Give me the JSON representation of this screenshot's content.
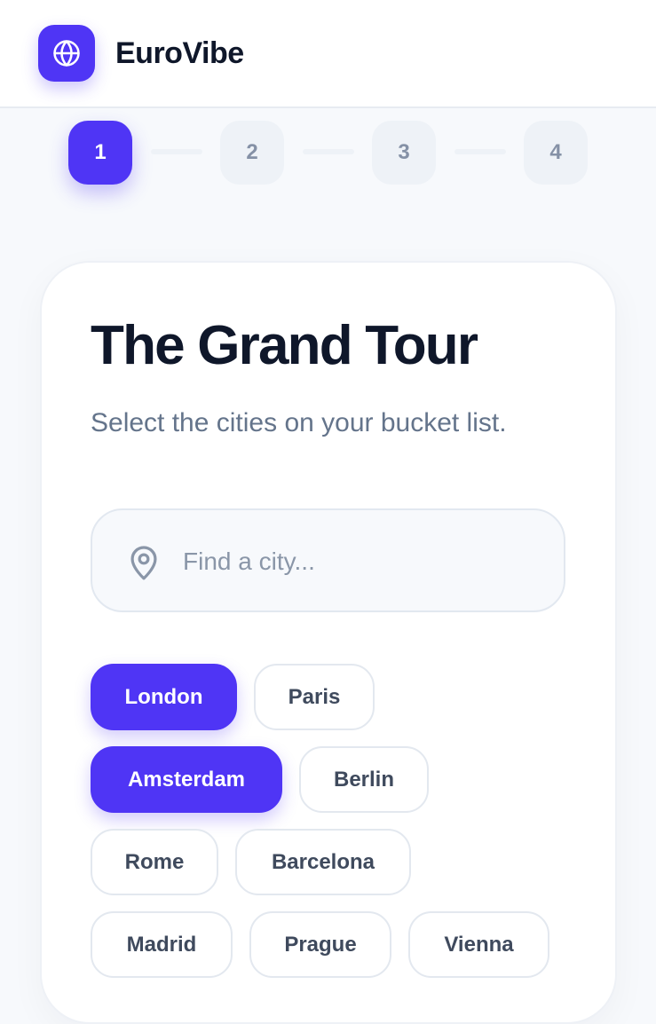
{
  "app": {
    "brand": "EuroVibe",
    "logo_icon": "globe-icon",
    "accent_color": "#4f35f5"
  },
  "stepper": {
    "steps": [
      {
        "label": "1",
        "active": true
      },
      {
        "label": "2",
        "active": false
      },
      {
        "label": "3",
        "active": false
      },
      {
        "label": "4",
        "active": false
      }
    ]
  },
  "main": {
    "title": "The Grand Tour",
    "subtitle": "Select the cities on your bucket list.",
    "search": {
      "placeholder": "Find a city...",
      "value": "",
      "icon": "map-pin-icon"
    },
    "cities": [
      {
        "label": "London",
        "selected": true
      },
      {
        "label": "Paris",
        "selected": false
      },
      {
        "label": "Amsterdam",
        "selected": true
      },
      {
        "label": "Berlin",
        "selected": false
      },
      {
        "label": "Rome",
        "selected": false
      },
      {
        "label": "Barcelona",
        "selected": false
      },
      {
        "label": "Madrid",
        "selected": false
      },
      {
        "label": "Prague",
        "selected": false
      },
      {
        "label": "Vienna",
        "selected": false
      }
    ]
  }
}
